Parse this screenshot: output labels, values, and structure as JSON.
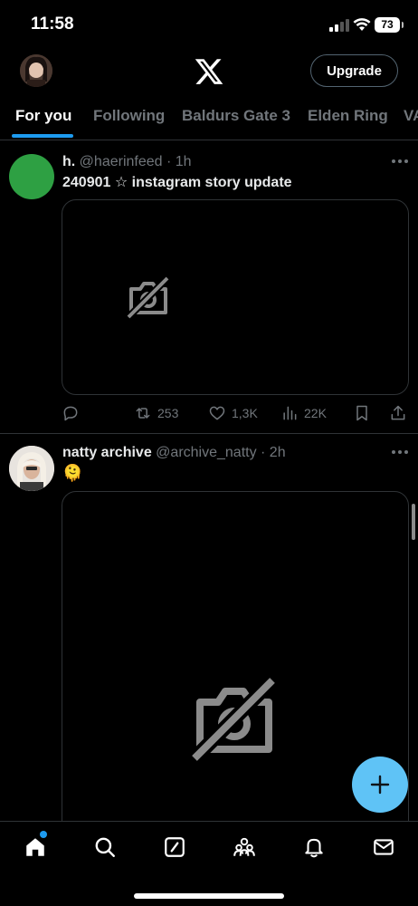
{
  "status_bar": {
    "time": "11:58",
    "battery": "73"
  },
  "header": {
    "logo": "x-logo-icon",
    "upgrade_label": "Upgrade"
  },
  "tabs": [
    {
      "label": "For you",
      "active": true
    },
    {
      "label": "Following",
      "active": false
    },
    {
      "label": "Baldurs Gate 3",
      "active": false
    },
    {
      "label": "Elden Ring",
      "active": false
    },
    {
      "label": "VA",
      "active": false
    }
  ],
  "posts": [
    {
      "name": "h.",
      "handle": "@haerinfeed",
      "time": "· 1h",
      "text": "240901 ☆ instagram story update",
      "media": "image-unavailable-icon",
      "actions": {
        "reply": "",
        "repost": "253",
        "like": "1,3K",
        "views": "22K"
      }
    },
    {
      "name": "natty archive",
      "handle": "@archive_natty",
      "time": "· 2h",
      "text": "🫠",
      "media": "image-unavailable-icon"
    }
  ],
  "fab": {
    "icon": "plus-icon"
  },
  "bottom_nav": [
    "home-icon",
    "search-icon",
    "grok-icon",
    "communities-icon",
    "notifications-icon",
    "messages-icon"
  ],
  "colors": {
    "accent": "#1d9bf0",
    "fab": "#5fc3f6",
    "muted": "#71767b",
    "border": "#2f3336",
    "avatar_green": "#2ea043"
  }
}
